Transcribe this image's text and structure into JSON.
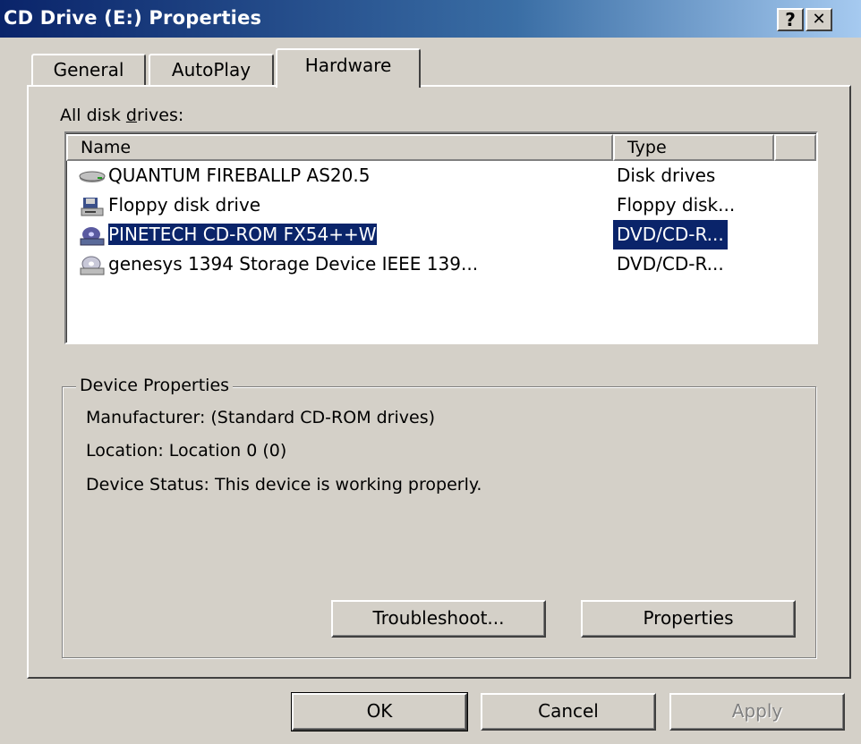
{
  "window": {
    "title": "CD Drive (E:) Properties",
    "help_label": "?",
    "close_label": "✕"
  },
  "tabs": [
    {
      "label": "General"
    },
    {
      "label": "AutoPlay"
    },
    {
      "label": "Hardware",
      "active": true
    }
  ],
  "hardware": {
    "drives_label": "All disk drives:",
    "columns": {
      "name": "Name",
      "type": "Type"
    },
    "drives": [
      {
        "name": "QUANTUM FIREBALLP AS20.5",
        "type": "Disk drives",
        "icon": "hard-disk-icon"
      },
      {
        "name": "Floppy disk drive",
        "type": "Floppy disk...",
        "icon": "floppy-drive-icon"
      },
      {
        "name": "PINETECH CD-ROM FX54++W",
        "type": "DVD/CD-R...",
        "icon": "cd-drive-icon",
        "selected": true
      },
      {
        "name": "genesys 1394 Storage Device IEEE 139...",
        "type": "DVD/CD-R...",
        "icon": "cd-drive-icon"
      }
    ],
    "device_properties": {
      "title": "Device Properties",
      "manufacturer": "Manufacturer: (Standard CD-ROM drives)",
      "location": "Location: Location 0 (0)",
      "status": "Device Status: This device is working properly."
    },
    "troubleshoot_label": "Troubleshoot...",
    "properties_label": "Properties"
  },
  "footer": {
    "ok_label": "OK",
    "cancel_label": "Cancel",
    "apply_label": "Apply"
  },
  "colors": {
    "face": "#d4d0c8",
    "titlebar_start": "#0a246a",
    "titlebar_end": "#a6caf0",
    "selection": "#0a246a"
  }
}
